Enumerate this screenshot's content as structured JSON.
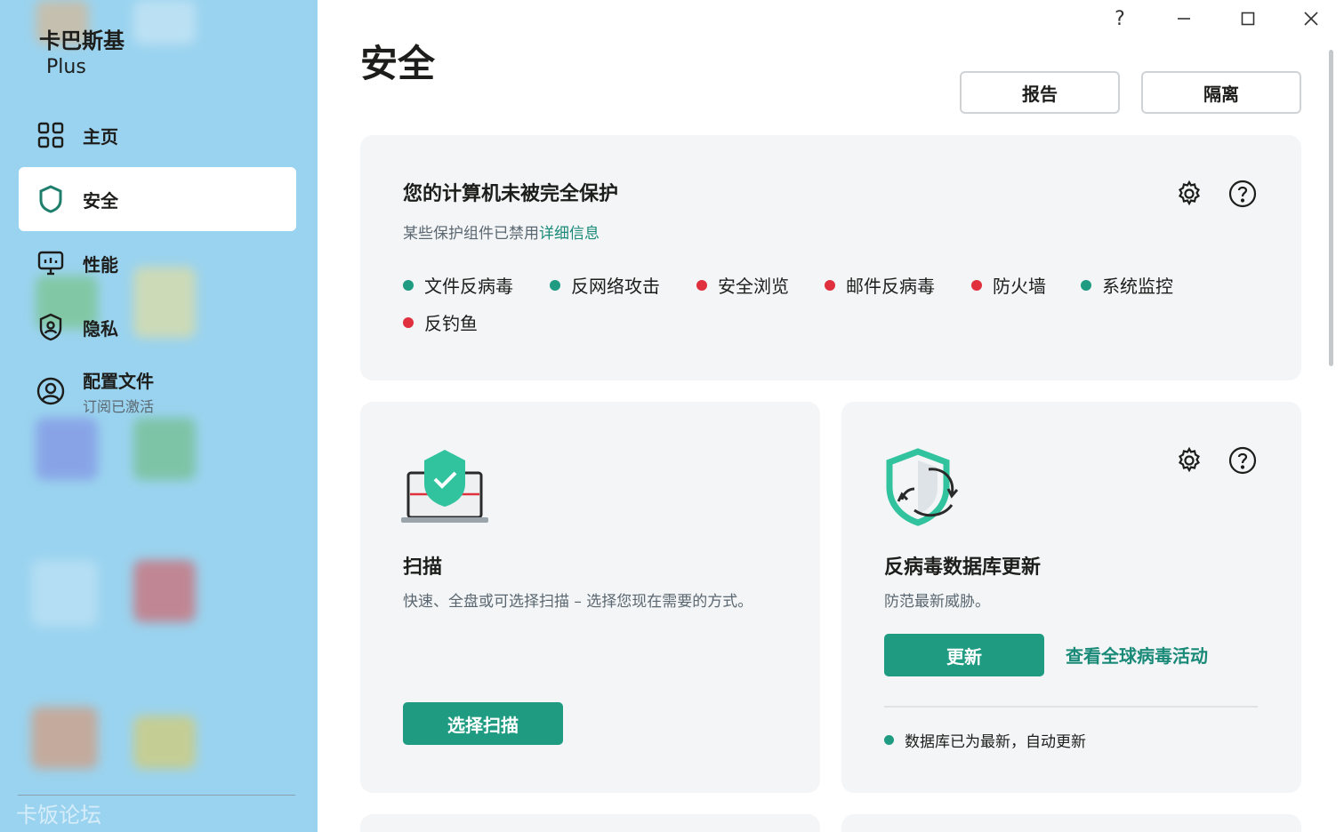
{
  "app": {
    "brand_name": "卡巴斯基",
    "brand_edition": "Plus"
  },
  "window_controls": {
    "help": "?",
    "minimize": "—",
    "maximize": "☐",
    "close": "✕"
  },
  "sidebar": {
    "items": [
      {
        "label": "主页",
        "icon": "grid-icon"
      },
      {
        "label": "安全",
        "icon": "shield-icon",
        "active": true
      },
      {
        "label": "性能",
        "icon": "monitor-icon"
      },
      {
        "label": "隐私",
        "icon": "privacy-shield-icon"
      },
      {
        "label": "配置文件",
        "sublabel": "订阅已激活",
        "icon": "user-circle-icon"
      }
    ],
    "watermark": "卡饭论坛"
  },
  "main": {
    "title": "安全",
    "report_button": "报告",
    "quarantine_button": "隔离"
  },
  "protection_card": {
    "title": "您的计算机未被完全保护",
    "desc_prefix": "某些保护组件已禁用",
    "desc_link": "详细信息",
    "components": [
      {
        "label": "文件反病毒",
        "status": "on"
      },
      {
        "label": "反网络攻击",
        "status": "on"
      },
      {
        "label": "安全浏览",
        "status": "off"
      },
      {
        "label": "邮件反病毒",
        "status": "off"
      },
      {
        "label": "防火墙",
        "status": "off"
      },
      {
        "label": "系统监控",
        "status": "on"
      },
      {
        "label": "反钓鱼",
        "status": "off"
      }
    ]
  },
  "scan_card": {
    "title": "扫描",
    "desc": "快速、全盘或可选择扫描 – 选择您现在需要的方式。",
    "button": "选择扫描"
  },
  "update_card": {
    "title": "反病毒数据库更新",
    "desc": "防范最新威胁。",
    "button": "更新",
    "link": "查看全球病毒活动",
    "status": "数据库已为最新，自动更新"
  },
  "colors": {
    "accent": "#1f9b82",
    "ok": "#1f9b82",
    "danger": "#e0303e",
    "sidebar_bg": "#9ad3ef",
    "card_bg": "#f3f5f7"
  }
}
